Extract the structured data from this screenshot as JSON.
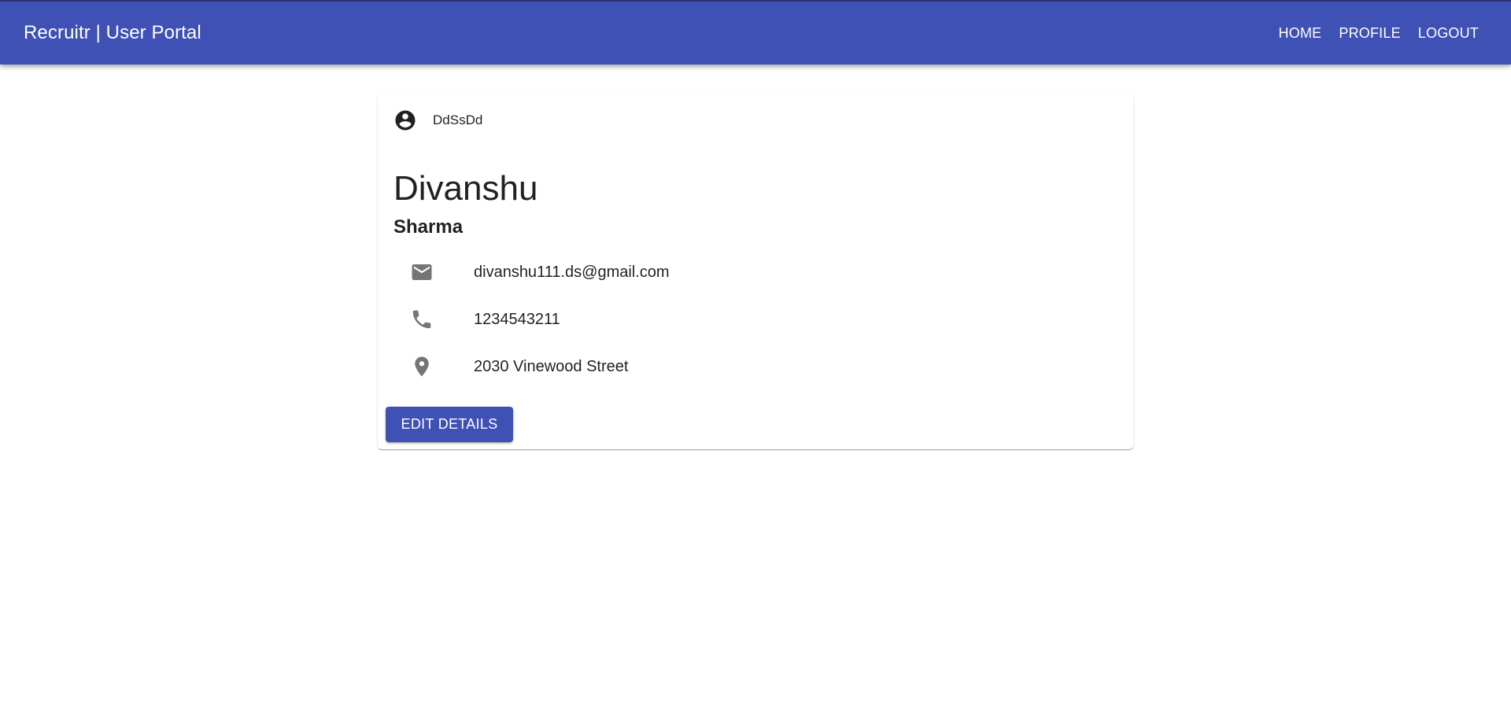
{
  "header": {
    "title": "Recruitr | User Portal",
    "nav": [
      {
        "label": "HOME"
      },
      {
        "label": "PROFILE"
      },
      {
        "label": "LOGOUT"
      }
    ]
  },
  "profile": {
    "username": "DdSsDd",
    "username_icon": "account-circle-icon",
    "first_name": "Divanshu",
    "last_name": "Sharma",
    "details": [
      {
        "icon": "email-icon",
        "value": "divanshu111.ds@gmail.com"
      },
      {
        "icon": "phone-icon",
        "value": "1234543211"
      },
      {
        "icon": "location-pin-icon",
        "value": "2030 Vinewood Street"
      }
    ],
    "edit_button_label": "EDIT DETAILS"
  },
  "colors": {
    "primary": "#3f51b5",
    "icon_gray": "#757575",
    "text": "#212121",
    "background": "#ffffff"
  }
}
